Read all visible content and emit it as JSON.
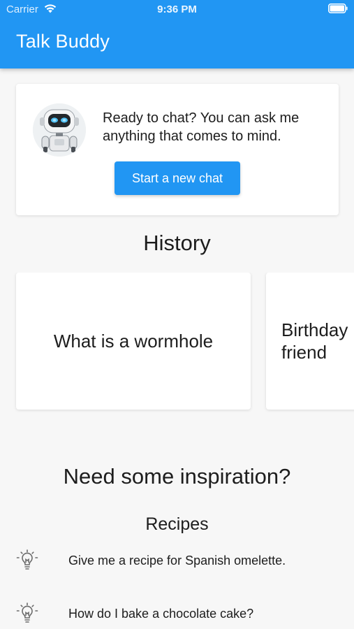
{
  "status_bar": {
    "carrier": "Carrier",
    "time": "9:36 PM",
    "wifi_icon": "wifi-icon",
    "battery_icon": "battery-icon"
  },
  "app_bar": {
    "title": "Talk Buddy",
    "color": "#2196f3"
  },
  "chat_card": {
    "avatar_icon": "robot-avatar",
    "prompt": "Ready to chat? You can ask me anything that comes to mind.",
    "button_label": "Start a new chat"
  },
  "history": {
    "heading": "History",
    "items": [
      {
        "label": "What is a wormhole"
      },
      {
        "label": "Birthday friend"
      }
    ]
  },
  "inspiration": {
    "heading": "Need some inspiration?",
    "category": "Recipes",
    "icon": "lightbulb-icon",
    "suggestions": [
      {
        "text": "Give me a recipe for Spanish omelette."
      },
      {
        "text": "How do I bake a chocolate cake?"
      }
    ]
  }
}
